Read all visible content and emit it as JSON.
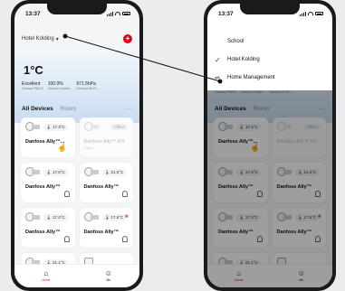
{
  "left_phone": {
    "status_time": "13:37",
    "home_name": "Hotel Kolding",
    "home_chevron": "▾",
    "add_label": "+",
    "weather": {
      "temperature": "1°C",
      "stats": [
        {
          "value": "Excellent",
          "label": "Outdoor PM2.5"
        },
        {
          "value": "100.0%",
          "label": "Outdoor Humid..."
        },
        {
          "value": "971.5hPa",
          "label": "Outdoor Air Pr..."
        }
      ]
    },
    "tabs": [
      {
        "label": "All Devices"
      },
      {
        "label": "Room"
      }
    ],
    "more_label": "···",
    "devices": [
      {
        "reading": "🌡 17.3°C",
        "name": "Danfoss Ally™...",
        "icon": "tap-hand-icon"
      },
      {
        "reading": "Offline",
        "name": "Danfoss Ally™ RS",
        "sub": "Offline",
        "offline": true
      },
      {
        "reading": "🌡 17.6°C",
        "name": "Danfoss Ally™",
        "icon": "bell-icon"
      },
      {
        "reading": "🌡 21.0°C",
        "name": "Danfoss Ally™",
        "icon": "bell-icon"
      },
      {
        "reading": "🌡 17.4°C",
        "name": "Danfoss Ally™",
        "icon": "bell-icon"
      },
      {
        "reading": "🌡 17.6°C",
        "name": "Danfoss Ally™",
        "icon": "bell-icon",
        "alert": "✻"
      },
      {
        "reading": "🌡 21.1°C"
      },
      {
        "reading": ""
      }
    ],
    "nav": [
      {
        "label": "Home",
        "icon": "⌂"
      },
      {
        "label": "Me",
        "icon": "☺"
      }
    ]
  },
  "right_phone": {
    "status_time": "13:37",
    "menu": [
      {
        "label": "School",
        "checked": false
      },
      {
        "label": "Hotel Kolding",
        "checked": true
      },
      {
        "label": "Home Management",
        "manage": true
      }
    ],
    "check_glyph": "✓",
    "manage_glyph": "⇌",
    "tabs": [
      {
        "label": "All Devices"
      },
      {
        "label": "Room"
      }
    ],
    "more_label": "···",
    "weather_stats_partial": [
      "Outdoor PM2.5",
      "Outdoor Humid...",
      "Outdoor Air Pr..."
    ],
    "devices": [
      {
        "reading": "🌡 17.3°C",
        "name": "Danfoss Ally™...",
        "icon": "tap-hand-icon"
      },
      {
        "reading": "Offline",
        "name": "Danfoss Ally™ RS",
        "offline": true
      },
      {
        "reading": "🌡 17.6°C",
        "name": "Danfoss Ally™",
        "icon": "bell-icon"
      },
      {
        "reading": "🌡 21.0°C",
        "name": "Danfoss Ally™",
        "icon": "bell-icon"
      },
      {
        "reading": "🌡 17.4°C",
        "name": "Danfoss Ally™",
        "icon": "bell-icon"
      },
      {
        "reading": "🌡 17.6°C",
        "name": "Danfoss Ally™",
        "icon": "bell-icon",
        "alert": "✻"
      },
      {
        "reading": "🌡 21.1°C"
      },
      {
        "reading": ""
      }
    ],
    "nav": [
      {
        "label": "Home",
        "icon": "⌂"
      },
      {
        "label": "Me",
        "icon": "☺"
      }
    ]
  },
  "colors": {
    "accent": "#e2001a",
    "pointer": "#111111"
  }
}
